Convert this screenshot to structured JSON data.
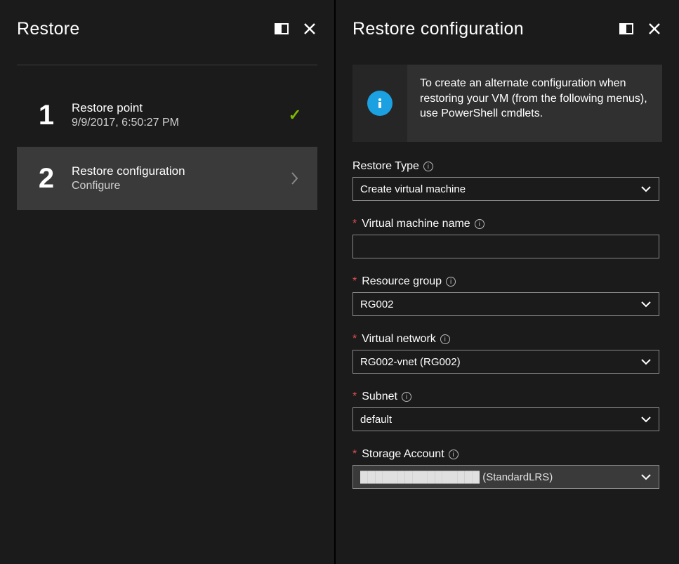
{
  "left": {
    "title": "Restore",
    "steps": [
      {
        "num": "1",
        "title": "Restore point",
        "sub": "9/9/2017, 6:50:27 PM",
        "status": "done"
      },
      {
        "num": "2",
        "title": "Restore configuration",
        "sub": "Configure",
        "status": "active"
      }
    ]
  },
  "right": {
    "title": "Restore configuration",
    "info": "To create an alternate configuration when restoring your VM (from the following menus), use PowerShell cmdlets.",
    "fields": {
      "restore_type": {
        "label": "Restore Type",
        "value": "Create virtual machine",
        "required": false
      },
      "vm_name": {
        "label": "Virtual machine name",
        "value": "",
        "required": true
      },
      "resource_group": {
        "label": "Resource group",
        "value": "RG002",
        "required": true
      },
      "vnet": {
        "label": "Virtual network",
        "value": "RG002-vnet (RG002)",
        "required": true
      },
      "subnet": {
        "label": "Subnet",
        "value": "default",
        "required": true
      },
      "storage": {
        "label": "Storage Account",
        "value": "████████████████ (StandardLRS)",
        "required": true,
        "disabled": true
      }
    }
  }
}
